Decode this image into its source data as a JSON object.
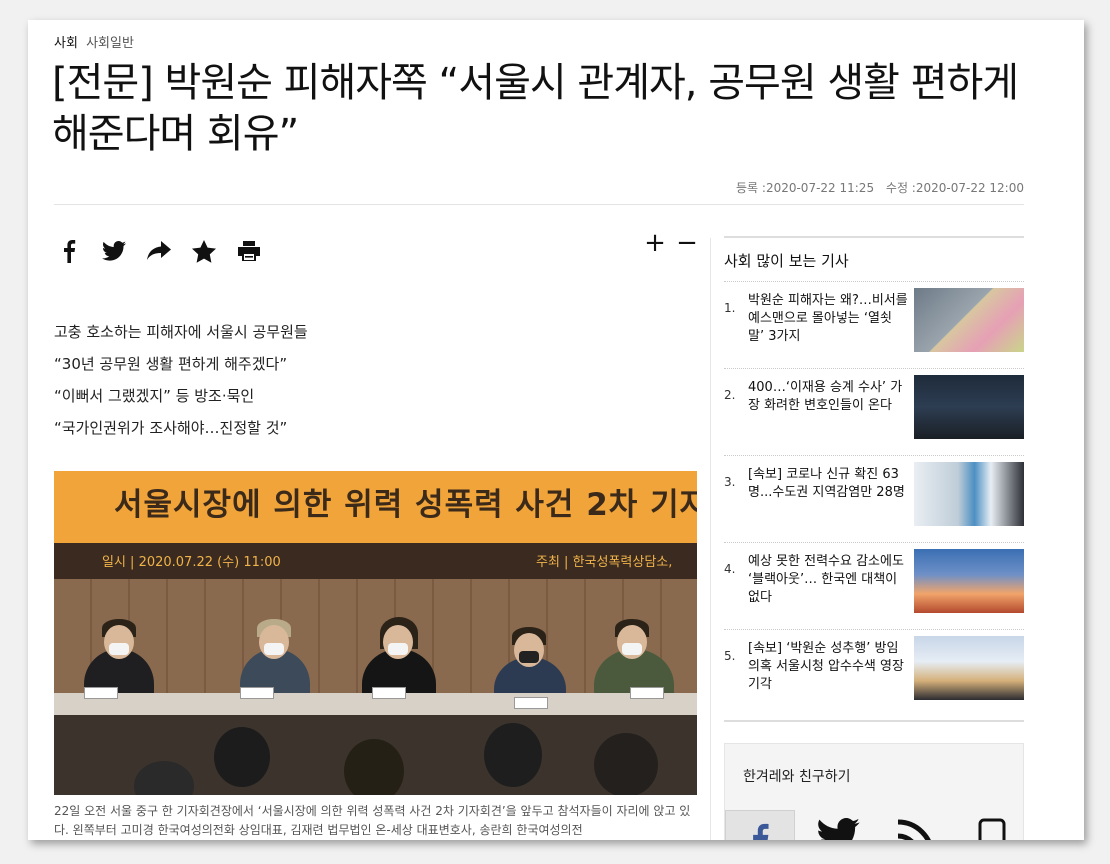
{
  "breadcrumb": {
    "section": "사회",
    "subsection": "사회일반"
  },
  "article": {
    "title": "[전문] 박원순 피해자쪽 “서울시 관계자, 공무원 생활 편하게 해준다며 회유”",
    "registered_label": "등록 :",
    "registered": "2020-07-22 11:25",
    "modified_label": "수정 :",
    "modified": "2020-07-22 12:00",
    "summary": [
      "고충 호소하는 피해자에 서울시 공무원들",
      "“30년 공무원 생활 편하게 해주겠다”",
      "“이뻐서 그랬겠지” 등 방조·묵인",
      "“국가인권위가 조사해야…진정할 것”"
    ],
    "photo": {
      "banner_title": "서울시장에 의한 위력 성폭력 사건 2차 기자",
      "date_line": "일시 | 2020.07.22 (수) 11:00",
      "host_line": "주최 | 한국성폭력상담소,"
    },
    "caption": "22일 오전 서울 중구 한 기자회견장에서 ‘서울시장에 의한 위력 성폭력 사건 2차 기자회견’을 앞두고 참석자들이 자리에 앉고 있다. 왼쪽부터 고미경 한국여성의전화 상임대표, 김재련 법무법인 온-세상 대표변호사, 송란희 한국여성의전"
  },
  "share_icons": [
    "facebook-icon",
    "twitter-icon",
    "share-icon",
    "star-icon",
    "print-icon"
  ],
  "font_controls": {
    "increase": "+",
    "decrease": "−"
  },
  "sidebar": {
    "popular_title": "사회 많이 보는 기사",
    "items": [
      {
        "num": "1.",
        "title": "박원순 피해자는 왜?…비서를 예스맨으로 몰아넣는 ‘열쇳말’ 3가지"
      },
      {
        "num": "2.",
        "title": "400…‘이재용 승계 수사’ 가장 화려한 변호인들이 온다"
      },
      {
        "num": "3.",
        "title": "[속보] 코로나 신규 확진 63명...수도권 지역감염만 28명"
      },
      {
        "num": "4.",
        "title": "예상 못한 전력수요 감소에도 ‘블랙아웃’… 한국엔 대책이 없다"
      },
      {
        "num": "5.",
        "title": "[속보] ‘박원순 성추행’ 방임 의혹 서울시청 압수수색 영장 기각"
      }
    ],
    "friends_title": "한겨레와 친구하기"
  }
}
